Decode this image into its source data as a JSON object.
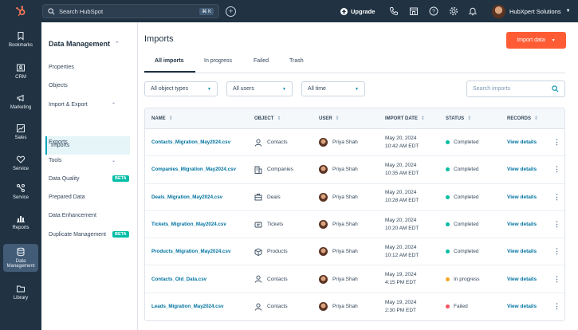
{
  "topbar": {
    "search_placeholder": "Search HubSpot",
    "shortcut_cmd": "⌘",
    "shortcut_key": "K",
    "upgrade_label": "Upgrade",
    "account_name": "HubXpert Solutions"
  },
  "leftnav": {
    "items": [
      {
        "label": "Bookmarks",
        "icon": "bookmark-icon"
      },
      {
        "label": "CRM",
        "icon": "contact-card-icon"
      },
      {
        "label": "Marketing",
        "icon": "megaphone-icon"
      },
      {
        "label": "Sales",
        "icon": "chart-icon"
      },
      {
        "label": "Service",
        "icon": "heart-icon"
      },
      {
        "label": "Service",
        "icon": "workflow-icon"
      },
      {
        "label": "Reports",
        "icon": "bar-chart-icon"
      },
      {
        "label": "Data",
        "label2": "Management",
        "icon": "database-icon"
      },
      {
        "label": "Library",
        "icon": "folder-icon"
      }
    ]
  },
  "dm_panel": {
    "title": "Data Management",
    "properties": "Properties",
    "objects": "Objects",
    "import_export": "Import & Export",
    "imports": "Imports",
    "exports": "Exports",
    "tools": "Tools",
    "data_quality": "Data Quality",
    "beta": "BETA",
    "prepared_data": "Prepared Data",
    "data_enhancement": "Data Enhancement",
    "duplicate_management": "Duplicate Management"
  },
  "main": {
    "title": "Imports",
    "import_button": "Import data",
    "tabs": [
      "All imports",
      "In progress",
      "Failed",
      "Trash"
    ],
    "filters": [
      "All object types",
      "All users",
      "All time"
    ],
    "search_placeholder": "Search imports"
  },
  "table": {
    "headers": [
      "NAME",
      "OBJECT",
      "USER",
      "IMPORT DATE",
      "STATUS",
      "RECORDS"
    ],
    "rows": [
      {
        "name": "Contacts_Migration_May2024.csv",
        "object": "Contacts",
        "object_icon": "person-icon",
        "user": "Priya Shah",
        "date": "May 20, 2024",
        "time": "10:42 AM EDT",
        "status": "Completed",
        "records": "View details"
      },
      {
        "name": "Companies_Migration_May2024.csv",
        "object": "Companies",
        "object_icon": "building-icon",
        "user": "Priya Shah",
        "date": "May 20, 2024",
        "time": "10:35 AM EDT",
        "status": "Completed",
        "records": "View details"
      },
      {
        "name": "Deals_Migration_May2024.csv",
        "object": "Deals",
        "object_icon": "briefcase-icon",
        "user": "Priya Shah",
        "date": "May 20, 2024",
        "time": "10:28 AM EDT",
        "status": "Completed",
        "records": "View details"
      },
      {
        "name": "Tickets_Migration_May2024.csv",
        "object": "Tickets",
        "object_icon": "ticket-icon",
        "user": "Priya Shah",
        "date": "May 20, 2024",
        "time": "10:20 AM EDT",
        "status": "Completed",
        "records": "View details"
      },
      {
        "name": "Products_Migration_May2024.csv",
        "object": "Products",
        "object_icon": "cube-icon",
        "user": "Priya Shah",
        "date": "May 20, 2024",
        "time": "10:12 AM EDT",
        "status": "Completed",
        "records": "View details"
      },
      {
        "name": "Contacts_Old_Data.csv",
        "object": "Contacts",
        "object_icon": "person-icon",
        "user": "Priya Shah",
        "date": "May 19, 2024",
        "time": "4:15 PM EDT",
        "status": "In progress",
        "records": "View details"
      },
      {
        "name": "Leads_Migration_May2024.csv",
        "object": "Contacts",
        "object_icon": "person-icon",
        "user": "Priya Shah",
        "date": "May 19, 2024",
        "time": "2:30 PM EDT",
        "status": "Failed",
        "records": "View details"
      }
    ]
  },
  "colors": {
    "completed": "#00bda5",
    "in_progress": "#f5a623",
    "failed": "#f2545b",
    "brand": "#ff5c35"
  }
}
